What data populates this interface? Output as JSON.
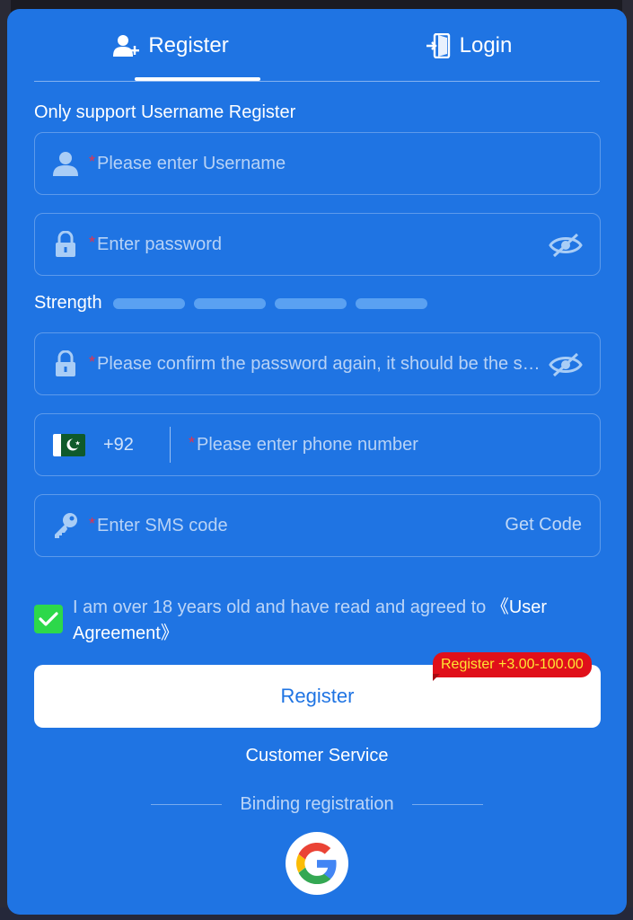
{
  "tabs": {
    "register_label": "Register",
    "login_label": "Login"
  },
  "register_note": "Only support Username Register",
  "username_field": {
    "required_mark": "*",
    "placeholder": "Please enter Username"
  },
  "password_field": {
    "required_mark": "*",
    "placeholder": "Enter password"
  },
  "strength": {
    "label": "Strength",
    "segments": 4
  },
  "confirm_field": {
    "required_mark": "*",
    "placeholder": "Please confirm the password again, it should be the same as the password"
  },
  "phone_field": {
    "country_flag": "pakistan-flag",
    "country_code": "+92",
    "required_mark": "*",
    "placeholder": "Please enter phone number"
  },
  "sms_field": {
    "required_mark": "*",
    "placeholder": "Enter SMS code",
    "get_code_label": "Get Code"
  },
  "agreement": {
    "checked": true,
    "text": "I am over 18 years old and have read and agreed to ",
    "link": "《User Agreement》"
  },
  "register_button": {
    "label": "Register",
    "bonus_badge": "Register +3.00-100.00"
  },
  "customer_service": "Customer Service",
  "binding_registration": "Binding registration",
  "social": [
    {
      "icon": "google-icon"
    }
  ],
  "colors": {
    "panel": "#1f74e3",
    "checkbox": "#2dd84a",
    "required": "#e7324a",
    "badge_bg": "#e0101a",
    "badge_text": "#ffe533"
  }
}
